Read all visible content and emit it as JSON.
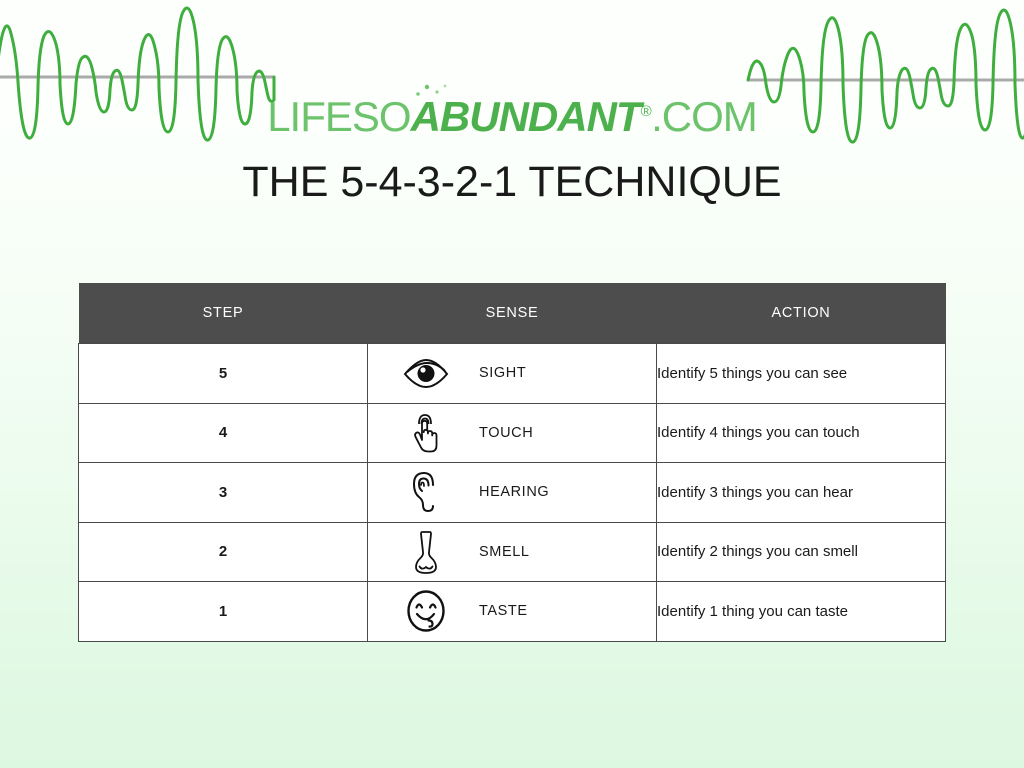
{
  "brand": {
    "logo_part1": "LIFESO",
    "logo_part2": "ABUNDANT",
    "logo_registered": "®",
    "logo_part3": ".COM",
    "accent_color": "#4cb14c",
    "light_color": "#6cc36c"
  },
  "page": {
    "title": "THE 5-4-3-2-1 TECHNIQUE",
    "background_top_color": "#fdfffd",
    "background_bottom_color": "#ddf8e1"
  },
  "decor": {
    "waveform_color": "#3fae3f",
    "baseline_color": "#aaaaaa",
    "left_waveform_name": "audio-waveform-left",
    "right_waveform_name": "audio-waveform-right"
  },
  "table": {
    "header_bg_color": "#4d4d4d",
    "header_text_color": "#ffffff",
    "border_color": "#4a4a4a",
    "columns": [
      "STEP",
      "SENSE",
      "ACTION"
    ],
    "rows": [
      {
        "step": "5",
        "icon": "eye-icon",
        "sense": "SIGHT",
        "action": "Identify 5 things you can see"
      },
      {
        "step": "4",
        "icon": "hand-tap-icon",
        "sense": "TOUCH",
        "action": "Identify 4 things you can touch"
      },
      {
        "step": "3",
        "icon": "ear-icon",
        "sense": "HEARING",
        "action": "Identify 3 things you can hear"
      },
      {
        "step": "2",
        "icon": "nose-icon",
        "sense": "SMELL",
        "action": "Identify 2 things you can smell"
      },
      {
        "step": "1",
        "icon": "tongue-smiley-icon",
        "sense": "TASTE",
        "action": "Identify 1 thing you can taste"
      }
    ]
  }
}
